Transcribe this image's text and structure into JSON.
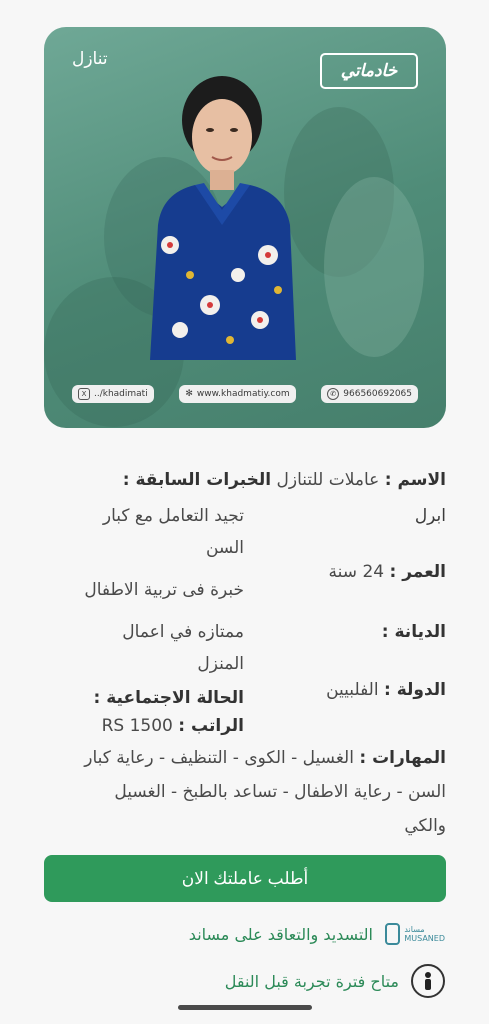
{
  "card": {
    "tag": "تنازل",
    "logo_text": "خادماتي",
    "contacts": [
      {
        "icon": "x-icon",
        "text": "../khadimati"
      },
      {
        "icon": "globe-icon",
        "text": "www.khadmatiy.com"
      },
      {
        "icon": "whatsapp-icon",
        "text": "966560692065"
      }
    ]
  },
  "details": {
    "name_label": "الاسم :",
    "name_value": "عاملات للتنازل",
    "experience_label": "الخبرات السابقة :",
    "name_value_line2": "ابرل",
    "experience_1a": "تجيد التعامل مع كبار",
    "experience_1b": "السن",
    "age_label": "العمر :",
    "age_value": "24 سنة",
    "experience_2": "خبرة فى تربية الاطفال",
    "religion_label": "الديانة :",
    "experience_3a": "ممتازه في اعمال",
    "experience_3b": "المنزل",
    "country_label": "الدولة :",
    "country_value": "الفلبيين",
    "marital_label": "الحالة الاجتماعية :",
    "salary_label": "الراتب :",
    "salary_value": "RS 1500",
    "skills_label": "المهارات :",
    "skills_line1": "الغسيل - الكوى - التنظيف - رعاية كبار",
    "skills_line2": "السن - رعاية الاطفال - تساعد بالطبخ - الغسيل",
    "skills_line3": "والكي"
  },
  "actions": {
    "order_button": "أطلب عاملتك الان",
    "musaned_text": "التسديد والتعاقد على مساند",
    "musaned_logo_text": "مساند",
    "musaned_logo_sub": "MUSANED",
    "trial_text": "متاح فترة تجربة قبل النقل"
  },
  "colors": {
    "primary": "#2f9a5b",
    "card_bg": "#5a9783"
  }
}
